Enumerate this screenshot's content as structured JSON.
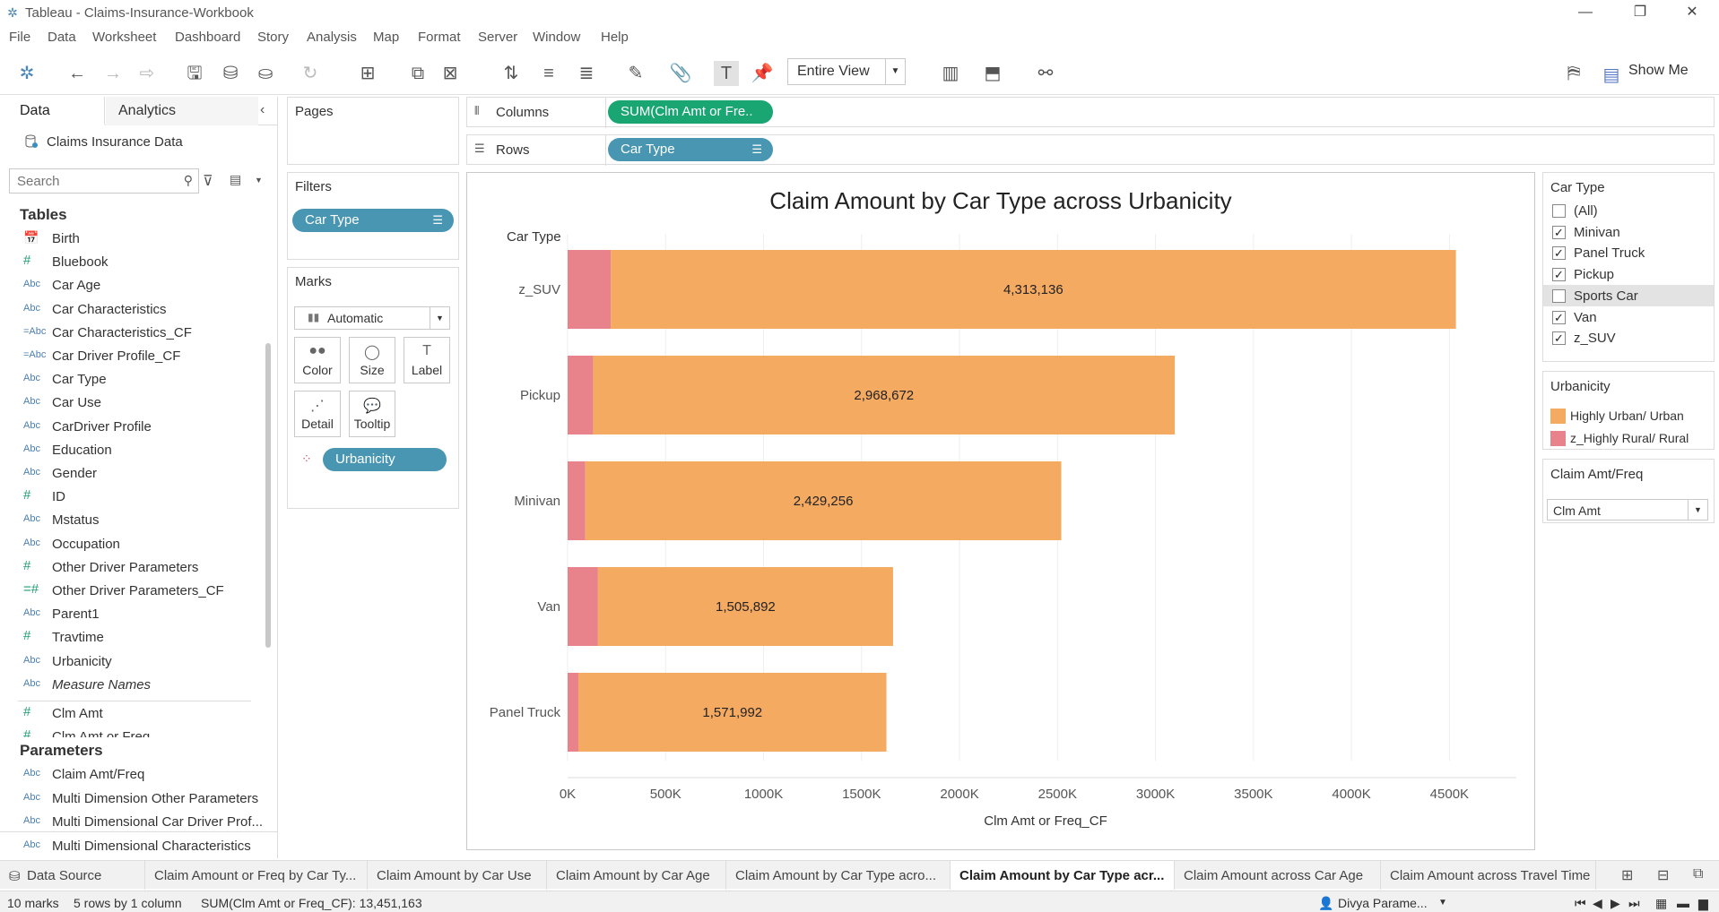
{
  "window": {
    "title": "Tableau - Claims-Insurance-Workbook",
    "logo_icon": "tableau-logo-icon",
    "minimize": "—",
    "restore": "❐",
    "close": "✕"
  },
  "menu": [
    "File",
    "Data",
    "Worksheet",
    "Dashboard",
    "Story",
    "Analysis",
    "Map",
    "Format",
    "Server",
    "Window",
    "Help"
  ],
  "toolbar": {
    "fit_value": "Entire View",
    "show_me": "Show Me"
  },
  "data_pane": {
    "tab_data": "Data",
    "tab_analytics": "Analytics",
    "datasource": "Claims Insurance Data",
    "search_placeholder": "Search",
    "tables_heading": "Tables",
    "fields": [
      {
        "type": "📅",
        "kind": "cal",
        "name": "Birth"
      },
      {
        "type": "#",
        "kind": "measure",
        "name": "Bluebook"
      },
      {
        "type": "Abc",
        "kind": "dim",
        "name": "Car Age"
      },
      {
        "type": "Abc",
        "kind": "dim",
        "name": "Car Characteristics"
      },
      {
        "type": "=Abc",
        "kind": "dim",
        "name": "Car Characteristics_CF"
      },
      {
        "type": "=Abc",
        "kind": "dim",
        "name": "Car Driver Profile_CF"
      },
      {
        "type": "Abc",
        "kind": "dim",
        "name": "Car Type"
      },
      {
        "type": "Abc",
        "kind": "dim",
        "name": "Car Use"
      },
      {
        "type": "Abc",
        "kind": "dim",
        "name": "CarDriver Profile"
      },
      {
        "type": "Abc",
        "kind": "dim",
        "name": "Education"
      },
      {
        "type": "Abc",
        "kind": "dim",
        "name": "Gender"
      },
      {
        "type": "#",
        "kind": "measure",
        "name": "ID"
      },
      {
        "type": "Abc",
        "kind": "dim",
        "name": "Mstatus"
      },
      {
        "type": "Abc",
        "kind": "dim",
        "name": "Occupation"
      },
      {
        "type": "#",
        "kind": "measure",
        "name": "Other Driver Parameters"
      },
      {
        "type": "=#",
        "kind": "measure",
        "name": "Other Driver Parameters_CF"
      },
      {
        "type": "Abc",
        "kind": "dim",
        "name": "Parent1"
      },
      {
        "type": "#",
        "kind": "measure",
        "name": "Travtime"
      },
      {
        "type": "Abc",
        "kind": "dim",
        "name": "Urbanicity"
      },
      {
        "type": "Abc",
        "kind": "dim",
        "name": "Measure Names",
        "italic": true
      },
      {
        "type": "#",
        "kind": "measure",
        "name": "Clm Amt"
      },
      {
        "type": "#",
        "kind": "measure",
        "name": "Clm Amt or Freq"
      }
    ],
    "parameters_heading": "Parameters",
    "parameters": [
      {
        "type": "Abc",
        "name": "Claim Amt/Freq"
      },
      {
        "type": "Abc",
        "name": "Multi Dimension Other Parameters"
      },
      {
        "type": "Abc",
        "name": "Multi Dimensional Car Driver Prof..."
      },
      {
        "type": "Abc",
        "name": "Multi Dimensional Characteristics"
      }
    ]
  },
  "cards": {
    "pages": "Pages",
    "filters": "Filters",
    "filter_pill": "Car Type",
    "marks": "Marks",
    "mark_type": "Automatic",
    "mark_buttons": [
      {
        "icon": "●●",
        "label": "Color"
      },
      {
        "icon": "◯",
        "label": "Size"
      },
      {
        "icon": "T",
        "label": "Label"
      },
      {
        "icon": "⋰",
        "label": "Detail"
      },
      {
        "icon": "💬",
        "label": "Tooltip"
      }
    ],
    "marks_pill": "Urbanicity"
  },
  "shelves": {
    "columns_label": "Columns",
    "columns_pill": "SUM(Clm Amt or Fre..",
    "rows_label": "Rows",
    "rows_pill": "Car Type"
  },
  "chart_data": {
    "type": "bar",
    "orientation": "horizontal",
    "stacked": true,
    "title": "Claim Amount by Car Type across Urbanicity",
    "row_header": "Car Type",
    "xlabel": "Clm Amt or Freq_CF",
    "categories": [
      "z_SUV",
      "Pickup",
      "Minivan",
      "Van",
      "Panel Truck"
    ],
    "series": [
      {
        "name": "z_Highly Rural/ Rural",
        "color": "#e8828b",
        "values": [
          220000,
          130000,
          90000,
          155000,
          55000
        ]
      },
      {
        "name": "Highly Urban/ Urban",
        "color": "#f5aa62",
        "values": [
          4313136,
          2968672,
          2429256,
          1505892,
          1571992
        ]
      }
    ],
    "data_labels": [
      "4,313,136",
      "2,968,672",
      "2,429,256",
      "1,505,892",
      "1,571,992"
    ],
    "xlim": [
      0,
      4750000
    ],
    "xticks": [
      0,
      500000,
      1000000,
      1500000,
      2000000,
      2500000,
      3000000,
      3500000,
      4000000,
      4500000
    ],
    "xtick_labels": [
      "0K",
      "500K",
      "1000K",
      "1500K",
      "2000K",
      "2500K",
      "3000K",
      "3500K",
      "4000K",
      "4500K"
    ],
    "grid": true
  },
  "legends": {
    "car_type_title": "Car Type",
    "car_type_items": [
      {
        "label": "(All)",
        "checked": false
      },
      {
        "label": "Minivan",
        "checked": true
      },
      {
        "label": "Panel Truck",
        "checked": true
      },
      {
        "label": "Pickup",
        "checked": true
      },
      {
        "label": "Sports Car",
        "checked": false,
        "highlighted": true
      },
      {
        "label": "Van",
        "checked": true
      },
      {
        "label": "z_SUV",
        "checked": true
      }
    ],
    "urbanicity_title": "Urbanicity",
    "urbanicity_items": [
      {
        "label": "Highly Urban/ Urban",
        "color": "#f5aa62"
      },
      {
        "label": "z_Highly Rural/ Rural",
        "color": "#e8828b"
      }
    ],
    "param_title": "Claim Amt/Freq",
    "param_value": "Clm Amt"
  },
  "sheet_tabs": {
    "datasource": "Data Source",
    "tabs": [
      {
        "label": "Claim Amount or Freq by Car Ty...",
        "active": false
      },
      {
        "label": "Claim Amount by Car Use",
        "active": false
      },
      {
        "label": "Claim Amount by Car Age",
        "active": false
      },
      {
        "label": "Claim Amount by Car Type acro...",
        "active": false
      },
      {
        "label": "Claim Amount by Car Type acr...",
        "active": true
      },
      {
        "label": "Claim Amount across Car Age",
        "active": false
      },
      {
        "label": "Claim Amount across Travel Time",
        "active": false
      }
    ]
  },
  "status": {
    "marks": "10 marks",
    "dims": "5 rows by 1 column",
    "sum": "SUM(Clm Amt or Freq_CF): 13,451,163",
    "user": "Divya Parame..."
  }
}
